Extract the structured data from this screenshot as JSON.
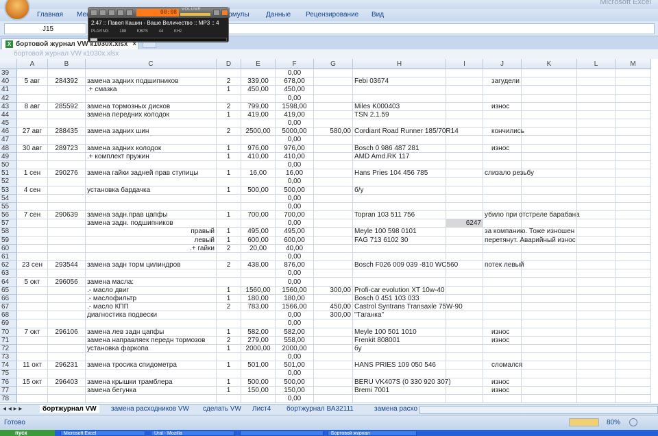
{
  "window": {
    "title": "Microsoft Excel"
  },
  "ribbon": {
    "tabs": [
      "Главная",
      "Меню",
      "Формулы",
      "Данные",
      "Рецензирование",
      "Вид"
    ]
  },
  "formula_bar": {
    "name_box": "J15",
    "formula": ""
  },
  "document": {
    "tab_label": "бортовой журнал VW к1030х.xlsx",
    "tab_close": "×",
    "workbook_title": "бортовой журнал VW к1030х.xlsx"
  },
  "player": {
    "time": "00:08",
    "track": "2:47 :: Павел Кашин - Ваше Величество :: MP3 :: 4",
    "status": "PLAYING",
    "bitrate": "188 KBPS",
    "rate": "44 KHz",
    "volume_label": "VOLUME",
    "progress": 0.05
  },
  "columns": [
    "A",
    "B",
    "C",
    "D",
    "E",
    "F",
    "G",
    "H",
    "I",
    "J",
    "K",
    "L",
    "M"
  ],
  "rows": [
    [
      "39",
      "",
      "",
      "",
      "",
      "",
      "0,00",
      "",
      "",
      "",
      ""
    ],
    [
      "40",
      "5 авг",
      "284392",
      "замена задних подшипников",
      "2",
      "339,00",
      "678,00",
      "",
      "Febi 03674",
      "",
      "загудели"
    ],
    [
      "41",
      "",
      "",
      ".+ смазка",
      "1",
      "450,00",
      "450,00",
      "",
      "",
      "",
      ""
    ],
    [
      "42",
      "",
      "",
      "",
      "",
      "",
      "0,00",
      "",
      "",
      "",
      ""
    ],
    [
      "43",
      "8 авг",
      "285592",
      "замена тормозных дисков",
      "2",
      "799,00",
      "1598,00",
      "",
      "Miles K000403",
      "",
      "износ"
    ],
    [
      "44",
      "",
      "",
      "замена передних колодок",
      "1",
      "419,00",
      "419,00",
      "",
      "TSN 2.1.59",
      "",
      ""
    ],
    [
      "45",
      "",
      "",
      "",
      "",
      "",
      "0,00",
      "",
      "",
      "",
      ""
    ],
    [
      "46",
      "27 авг",
      "288435",
      "замена задних шин",
      "2",
      "2500,00",
      "5000,00",
      "580,00",
      "Cordiant Road Runner 185/70R14",
      "",
      "кончились"
    ],
    [
      "47",
      "",
      "",
      "",
      "",
      "",
      "0,00",
      "",
      "",
      "",
      ""
    ],
    [
      "48",
      "30 авг",
      "289723",
      "замена задних колодок",
      "1",
      "976,00",
      "976,00",
      "",
      "Bosch 0 986 487 281",
      "",
      "износ"
    ],
    [
      "49",
      "",
      "",
      ".+ комплект пружин",
      "1",
      "410,00",
      "410,00",
      "",
      "AMD  Amd.RK 117",
      "",
      ""
    ],
    [
      "50",
      "",
      "",
      "",
      "",
      "",
      "0,00",
      "",
      "",
      "",
      ""
    ],
    [
      "51",
      "1 сен",
      "290276",
      "замена гайки задней прав ступицы",
      "1",
      "16,00",
      "16,00",
      "",
      "Hans Pries 104 456 785",
      "",
      "слизало резьбу"
    ],
    [
      "52",
      "",
      "",
      "",
      "",
      "",
      "0,00",
      "",
      "",
      "",
      ""
    ],
    [
      "53",
      "4 сен",
      "",
      "установка бардачка",
      "1",
      "500,00",
      "500,00",
      "",
      "б/у",
      "",
      ""
    ],
    [
      "54",
      "",
      "",
      "",
      "",
      "",
      "0,00",
      "",
      "",
      "",
      ""
    ],
    [
      "55",
      "",
      "",
      "",
      "",
      "",
      "0,00",
      "",
      "",
      "",
      ""
    ],
    [
      "56",
      "7 сен",
      "290639",
      "замена задн.прав цапфы",
      "1",
      "700,00",
      "700,00",
      "",
      "Topran 103 511 756",
      "",
      "убило при отстреле барабана"
    ],
    [
      "57",
      "",
      "",
      "замена задн. подшипников",
      "",
      "",
      "0,00",
      "",
      "",
      "6247",
      ""
    ],
    [
      "58",
      "",
      "",
      "правый",
      "1",
      "495,00",
      "495,00",
      "",
      "Meyle 100 598 0101",
      "",
      "за компанию. Тоже изношен"
    ],
    [
      "59",
      "",
      "",
      "левый",
      "1",
      "600,00",
      "600,00",
      "",
      "FAG 713 6102 30",
      "",
      "перетянут. Аварийный износ"
    ],
    [
      "60",
      "",
      "",
      ".+ гайки",
      "2",
      "20,00",
      "40,00",
      "",
      "",
      "",
      ""
    ],
    [
      "61",
      "",
      "",
      "",
      "",
      "",
      "0,00",
      "",
      "",
      "",
      ""
    ],
    [
      "62",
      "23 сен",
      "293544",
      "замена задн торм цилиндров",
      "2",
      "438,00",
      "876,00",
      "",
      "Bosch F026 009 039 -810    WC560",
      "",
      "потек левый"
    ],
    [
      "63",
      "",
      "",
      "",
      "",
      "",
      "0,00",
      "",
      "",
      "",
      ""
    ],
    [
      "64",
      "5 окт",
      "296056",
      "замена масла:",
      "",
      "",
      "0,00",
      "",
      "",
      "",
      ""
    ],
    [
      "65",
      "",
      "",
      ".- масло двиг",
      "1",
      "1560,00",
      "1560,00",
      "300,00",
      "Profi-car evolution XT 10w-40",
      "",
      ""
    ],
    [
      "66",
      "",
      "",
      ".- маслофильтр",
      "1",
      "180,00",
      "180,00",
      "",
      "Bosch 0 451 103 033",
      "",
      ""
    ],
    [
      "67",
      "",
      "",
      ".- масло КПП",
      "2",
      "783,00",
      "1566,00",
      "450,00",
      "Castrol Syntrans Transaxle 75W-90",
      "",
      ""
    ],
    [
      "68",
      "",
      "",
      "диагностика подвески",
      "",
      "",
      "0,00",
      "300,00",
      "\"Таганка\"",
      "",
      ""
    ],
    [
      "69",
      "",
      "",
      "",
      "",
      "",
      "0,00",
      "",
      "",
      "",
      ""
    ],
    [
      "70",
      "7 окт",
      "296106",
      "замена лев задн цапфы",
      "1",
      "582,00",
      "582,00",
      "",
      "Meyle 100 501 1010",
      "",
      "износ"
    ],
    [
      "71",
      "",
      "",
      "замена направляек передн тормозов",
      "2",
      "279,00",
      "558,00",
      "",
      "Frenkit 808001",
      "",
      "износ"
    ],
    [
      "72",
      "",
      "",
      "установка фаркопа",
      "1",
      "2000,00",
      "2000,00",
      "",
      "бу",
      "",
      ""
    ],
    [
      "73",
      "",
      "",
      "",
      "",
      "",
      "0,00",
      "",
      "",
      "",
      ""
    ],
    [
      "74",
      "11 окт",
      "296231",
      "замена тросика спидометра",
      "1",
      "501,00",
      "501,00",
      "",
      "HANS PRIES 109 050 546",
      "",
      "сломался"
    ],
    [
      "75",
      "",
      "",
      "",
      "",
      "",
      "0,00",
      "",
      "",
      "",
      ""
    ],
    [
      "76",
      "15 окт",
      "296403",
      "замена крышки трамблера",
      "1",
      "500,00",
      "500,00",
      "",
      "BERU VK407S (0 330 920 307)",
      "",
      "износ"
    ],
    [
      "77",
      "",
      "",
      "замена бегунка",
      "1",
      "150,00",
      "150,00",
      "",
      "Bremi 7001",
      "",
      "износ"
    ],
    [
      "78",
      "",
      "",
      "",
      "",
      "",
      "0,00",
      "",
      "",
      "",
      ""
    ]
  ],
  "sheet_tabs": [
    "бортжурнал VW",
    "замена расходников VW",
    "сделать VW",
    "Лист4",
    "бортжурнал ВА32111",
    "замена расхо"
  ],
  "status": {
    "text": "Готово",
    "zoom": "80%"
  },
  "taskbar": {
    "start": "пуск",
    "items": [
      "Microsoft Excel",
      "Ural - Mozilla",
      "",
      "Бортовой журнал"
    ]
  },
  "colors": {
    "ribbon": "#c7d8ee",
    "selected_cell": "#d8d8d8",
    "player_display": "#ff7a1a"
  }
}
